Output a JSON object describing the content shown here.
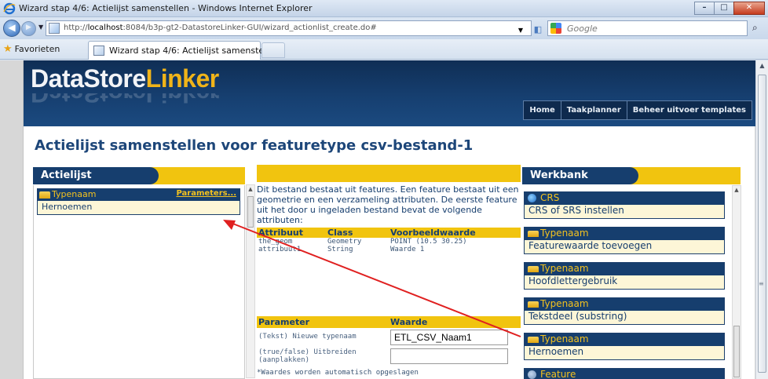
{
  "window": {
    "title": "Wizard stap 4/6: Actielijst samenstellen - Windows Internet Explorer",
    "minimize": "–",
    "maximize": "□",
    "close": "✕"
  },
  "browser": {
    "url_prefix": "http://",
    "url_host": "localhost",
    "url_rest": ":8084/b3p-gt2-DatastoreLinker-GUI/wizard_actionlist_create.do#",
    "search_placeholder": "Google",
    "favorites_label": "Favorieten",
    "tab_title": "Wizard stap 4/6: Actielijst samenstellen"
  },
  "header": {
    "logo_part1": "DataStore",
    "logo_part2": "Linker",
    "nav": [
      "Home",
      "Taakplanner",
      "Beheer uitvoer templates"
    ]
  },
  "page_title": "Actielijst samenstellen voor featuretype csv-bestand-1",
  "actielijst": {
    "title": "Actielijst",
    "items": [
      {
        "type": "Typenaam",
        "params_link": "Parameters...",
        "action": "Hernoemen"
      }
    ]
  },
  "middle": {
    "intro": "Dit bestand bestaat uit features. Een feature bestaat uit een geometrie en een verzameling attributen. De eerste feature uit het door u ingeladen bestand bevat de volgende attributen:",
    "attr_headers": [
      "Attribuut",
      "Class",
      "Voorbeeldwaarde"
    ],
    "attributes": [
      [
        "the_geom",
        "Geometry",
        "POINT (10.5 30.25)"
      ],
      [
        "attribuut1",
        "String",
        "Waarde 1"
      ]
    ],
    "param_headers": [
      "Parameter",
      "Waarde"
    ],
    "params": [
      {
        "label": "(Tekst) Nieuwe typenaam",
        "value": "ETL_CSV_Naam1"
      },
      {
        "label": "(true/false) Uitbreiden (aanplakken)",
        "value": ""
      }
    ],
    "note": "*Waardes worden automatisch opgeslagen"
  },
  "werkbank": {
    "title": "Werkbank",
    "items": [
      {
        "type": "CRS",
        "icon": "globe-icon",
        "action": "CRS of SRS instellen"
      },
      {
        "type": "Typenaam",
        "icon": "folder-icon",
        "action": "Featurewaarde toevoegen"
      },
      {
        "type": "Typenaam",
        "icon": "folder-icon",
        "action": "Hoofdlettergebruik"
      },
      {
        "type": "Typenaam",
        "icon": "folder-icon",
        "action": "Tekstdeel (substring)"
      },
      {
        "type": "Typenaam",
        "icon": "folder-icon",
        "action": "Hernoemen"
      },
      {
        "type": "Feature",
        "icon": "feature-icon",
        "action": ""
      }
    ]
  },
  "colors": {
    "brand_dark": "#163e6e",
    "brand_yellow": "#f1c40f",
    "arrow": "#e02020"
  }
}
